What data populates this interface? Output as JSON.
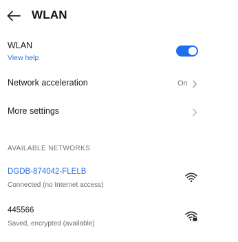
{
  "header": {
    "title": "WLAN",
    "back_icon": "arrow-left-icon"
  },
  "wlan": {
    "label": "WLAN",
    "help_link": "View help",
    "enabled": true,
    "accent_color": "#1f6ff2"
  },
  "acceleration": {
    "label": "Network acceleration",
    "value": "On"
  },
  "more_settings": {
    "label": "More settings"
  },
  "available": {
    "section_title": "AVAILABLE NETWORKS",
    "networks": [
      {
        "name": "DGDB-874042-FLELB",
        "status": "Connected (no Internet access)",
        "icon": "wifi-signal-icon",
        "connected": true,
        "name_color": "#2a6fe0"
      },
      {
        "name": "445566",
        "status": "Saved, encrypted (available)",
        "icon": "wifi-locked-icon",
        "connected": false
      }
    ]
  }
}
